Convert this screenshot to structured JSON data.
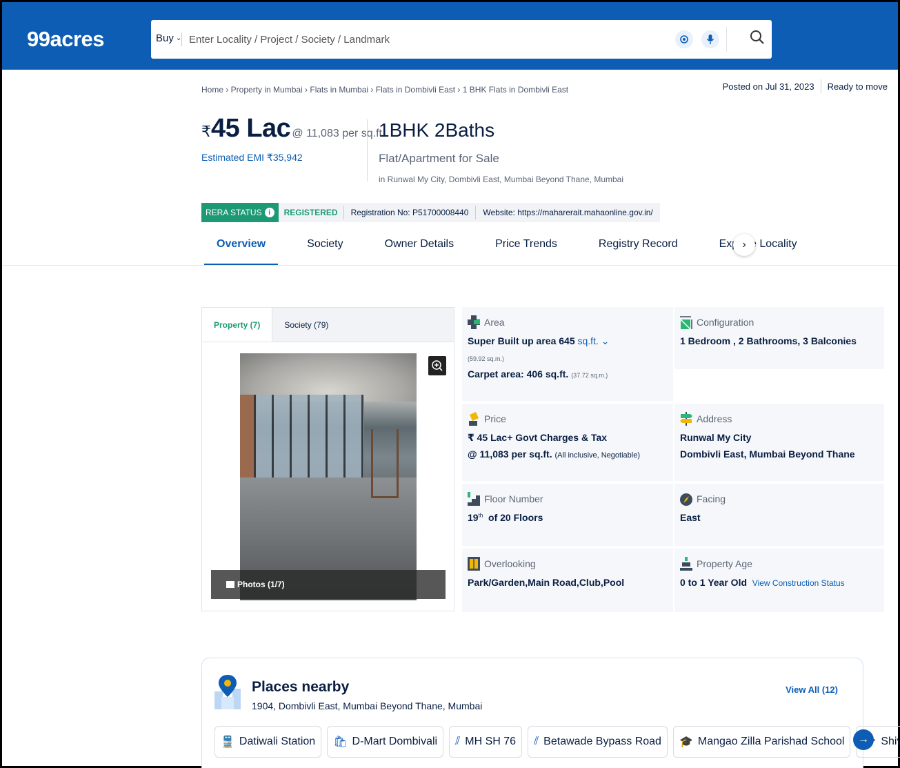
{
  "header": {
    "logo": "99acres",
    "buy_label": "Buy",
    "search_placeholder": "Enter Locality / Project / Society / Landmark"
  },
  "breadcrumb": "Home › Property in Mumbai › Flats in Mumbai › Flats in Dombivli East › 1 BHK Flats in Dombivli East",
  "posted": {
    "date": "Posted on Jul 31, 2023",
    "status": "Ready to move"
  },
  "price": {
    "symbol": "₹",
    "amount": "45 Lac",
    "per_sqft": "@ 11,083 per sq.ft.",
    "emi": "Estimated EMI ₹35,942"
  },
  "config": {
    "title": "1BHK 2Baths",
    "subtitle": "Flat/Apartment for Sale",
    "location": "in Runwal My City, Dombivli East, Mumbai Beyond Thane, Mumbai"
  },
  "rera": {
    "label": "RERA STATUS",
    "info": "i",
    "status": "REGISTERED",
    "reg_no": "Registration No: P51700008440",
    "website": "Website: https://maharerait.mahaonline.gov.in/"
  },
  "tabs": [
    "Overview",
    "Society",
    "Owner Details",
    "Price Trends",
    "Registry Record",
    "Explore Locality"
  ],
  "gallery": {
    "tab_property": "Property (7)",
    "tab_society": "Society (79)",
    "photos_label": "Photos (1/7)"
  },
  "details": {
    "area_label": "Area",
    "area_super": "Super Built up area 645",
    "area_unit": "sq.ft.",
    "area_super_sqm": "(59.92 sq.m.)",
    "area_carpet": "Carpet area: 406 sq.ft.",
    "area_carpet_sqm": "(37.72 sq.m.)",
    "config_label": "Configuration",
    "config_value": "1 Bedroom , 2 Bathrooms, 3 Balconies",
    "price_label": "Price",
    "price_line1": "₹ 45 Lac+ Govt Charges & Tax",
    "price_line2": "@ 11,083 per sq.ft.",
    "price_note": "(All inclusive, Negotiable)",
    "address_label": "Address",
    "address_line1": "Runwal My City",
    "address_line2": "Dombivli East, Mumbai Beyond Thane",
    "floor_label": "Floor Number",
    "floor_num": "19",
    "floor_sup": "th",
    "floor_total": "of 20 Floors",
    "facing_label": "Facing",
    "facing_value": "East",
    "overlooking_label": "Overlooking",
    "overlooking_value": "Park/Garden,Main Road,Club,Pool",
    "age_label": "Property Age",
    "age_value": "0 to 1 Year Old",
    "age_link": "View Construction Status"
  },
  "places": {
    "title": "Places nearby",
    "subtitle": "1904, Dombivli East, Mumbai Beyond Thane, Mumbai",
    "view_all": "View All (12)",
    "chips": [
      "Datiwali Station",
      "D-Mart Dombivali",
      "MH SH 76",
      "Betawade Bypass Road",
      "Mangao Zilla Parishad School",
      "Shivaji"
    ]
  },
  "colors": {
    "brand": "#0c5db3",
    "rera": "#1d9a74"
  }
}
